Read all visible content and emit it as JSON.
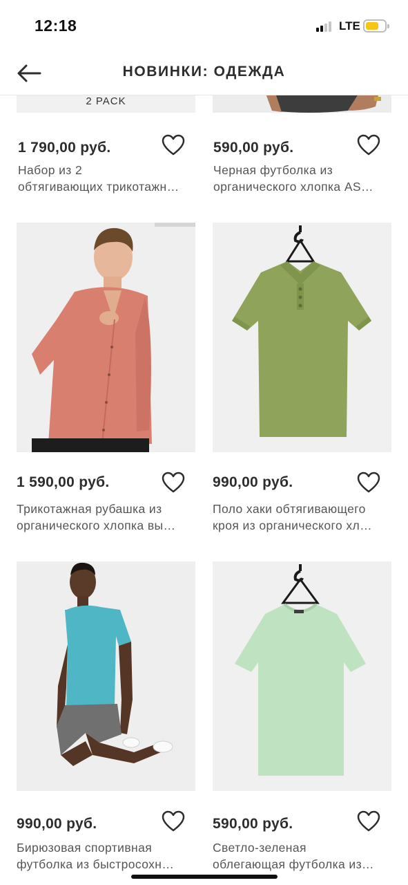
{
  "status": {
    "time": "12:18",
    "network": "LTE",
    "battery_color": "#f5c518"
  },
  "header": {
    "title": "НОВИНКИ: ОДЕЖДА",
    "back_icon": "arrow-left-icon"
  },
  "products": [
    {
      "price": "1 790,00 руб.",
      "name_line1": "Набор из 2",
      "name_line2": "обтягивающих трикотажн…",
      "image_label": "2 PACK",
      "image_colors": [
        "#f1f1f1"
      ]
    },
    {
      "price": "590,00 руб.",
      "name_line1": "Черная футболка из",
      "name_line2": "органического хлопка AS…",
      "image_colors": [
        "#ececec",
        "#3d3d3d"
      ]
    },
    {
      "price": "1 590,00 руб.",
      "name_line1": "Трикотажная рубашка из",
      "name_line2": "органического хлопка вы…",
      "image_colors": [
        "#efefef",
        "#d97f70"
      ]
    },
    {
      "price": "990,00 руб.",
      "name_line1": "Поло хаки обтягивающего",
      "name_line2": "кроя из органического хл…",
      "image_colors": [
        "#f0f0f0",
        "#8fa35a"
      ]
    },
    {
      "price": "990,00 руб.",
      "name_line1": "Бирюзовая спортивная",
      "name_line2": "футболка из быстросохн…",
      "image_colors": [
        "#eeeeee",
        "#4fb6c6"
      ]
    },
    {
      "price": "590,00 руб.",
      "name_line1": "Светло-зеленая",
      "name_line2": "облегающая футболка из…",
      "image_colors": [
        "#f0f0f0",
        "#bfe3c1"
      ]
    }
  ]
}
